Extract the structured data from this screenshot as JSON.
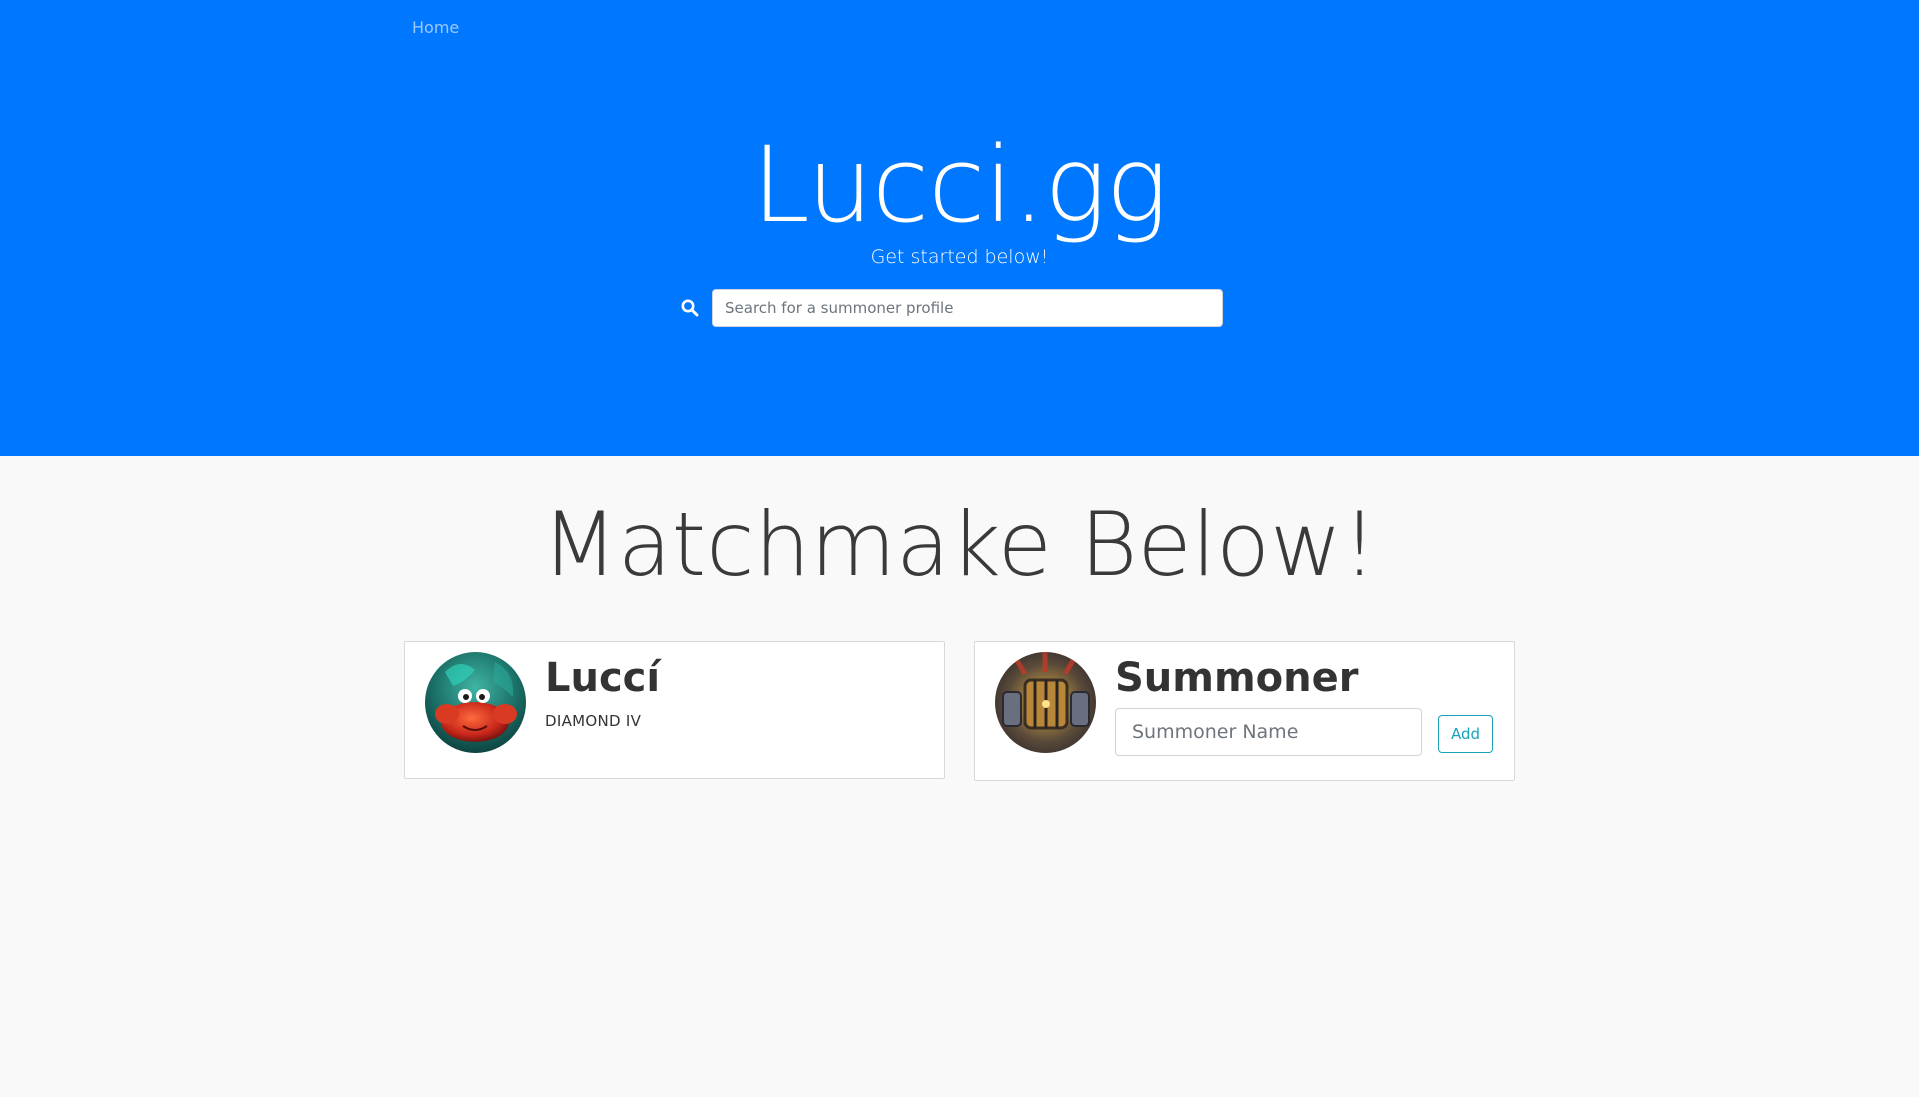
{
  "nav": {
    "home_label": "Home"
  },
  "hero": {
    "title": "Lucci.gg",
    "subtitle": "Get started below!",
    "search_placeholder": "Search for a summoner profile",
    "search_icon": "search-icon"
  },
  "main": {
    "section_title": "Matchmake Below!",
    "cards": [
      {
        "name": "Luccí",
        "rank": "DIAMOND IV",
        "avatar": "crab-champion-avatar"
      },
      {
        "name": "Summoner",
        "input_placeholder": "Summoner Name",
        "input_value": "",
        "add_label": "Add",
        "avatar": "cage-champion-avatar"
      }
    ]
  },
  "colors": {
    "hero_bg": "#0077ff",
    "page_bg": "#f9f9f9",
    "accent_outline": "#17a2b8"
  }
}
